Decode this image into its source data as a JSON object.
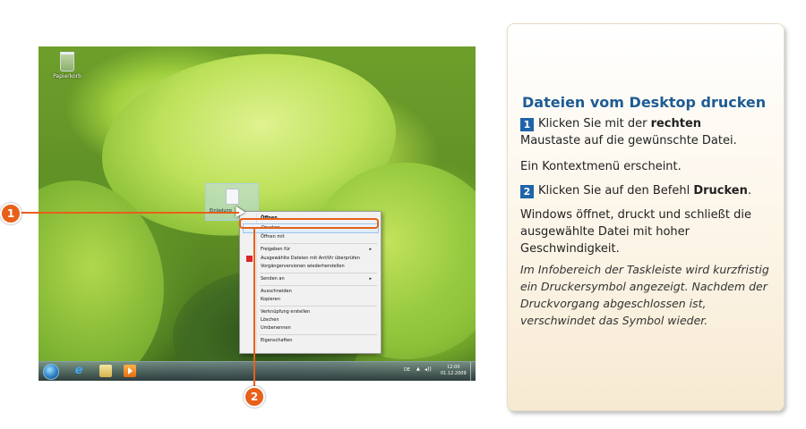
{
  "desktop": {
    "recycle_bin_label": "Papierkorb",
    "file_label": "Einladung"
  },
  "context_menu": {
    "items": [
      {
        "label": "Öffnen",
        "bold": true
      },
      {
        "label": "Drucken",
        "highlighted": true
      },
      {
        "label": "Öffnen mit"
      },
      {
        "label": "Freigeben für",
        "submenu": true
      },
      {
        "label": "Ausgewählte Dateien mit AntiVir überprüfen",
        "icon": "antivir-icon"
      },
      {
        "label": "Vorgängerversionen wiederherstellen"
      },
      {
        "label": "Senden an",
        "submenu": true
      },
      {
        "label": "Ausschneiden"
      },
      {
        "label": "Kopieren"
      },
      {
        "label": "Verknüpfung erstellen"
      },
      {
        "label": "Löschen"
      },
      {
        "label": "Umbenennen"
      },
      {
        "label": "Eigenschaften"
      }
    ],
    "submenu_arrow": "▸"
  },
  "taskbar": {
    "language": "DE",
    "tray_arrow": "▲",
    "volume_glyph": "◂))",
    "ie_glyph": "e",
    "time": "12:00",
    "date": "01.12.2009"
  },
  "callouts": {
    "marker_1": "1",
    "marker_2": "2"
  },
  "panel": {
    "title": "Dateien vom Desktop drucken",
    "step1_badge": "1",
    "step1_pre": "Klicken Sie mit der ",
    "step1_bold": "rechten",
    "step1_post": "Maustaste auf die gewünschte Datei.",
    "context_appears": "Ein Kontextmenü erscheint.",
    "step2_badge": "2",
    "step2_pre": "Klicken Sie auf den Befehl ",
    "step2_bold": "Drucken",
    "step2_post": ".",
    "result": "Windows öffnet, druckt und schließt die ausgewählte Datei mit hoher Geschwindigkeit.",
    "note": "Im Infobereich der Taskleiste wird kurzfristig ein Druckersymbol angezeigt. Nachdem der Druckvorgang abgeschlossen ist, verschwindet das Symbol wieder."
  },
  "colors": {
    "accent_orange": "#e8601a",
    "title_blue": "#1d5c94",
    "badge_blue": "#1f64a8"
  }
}
